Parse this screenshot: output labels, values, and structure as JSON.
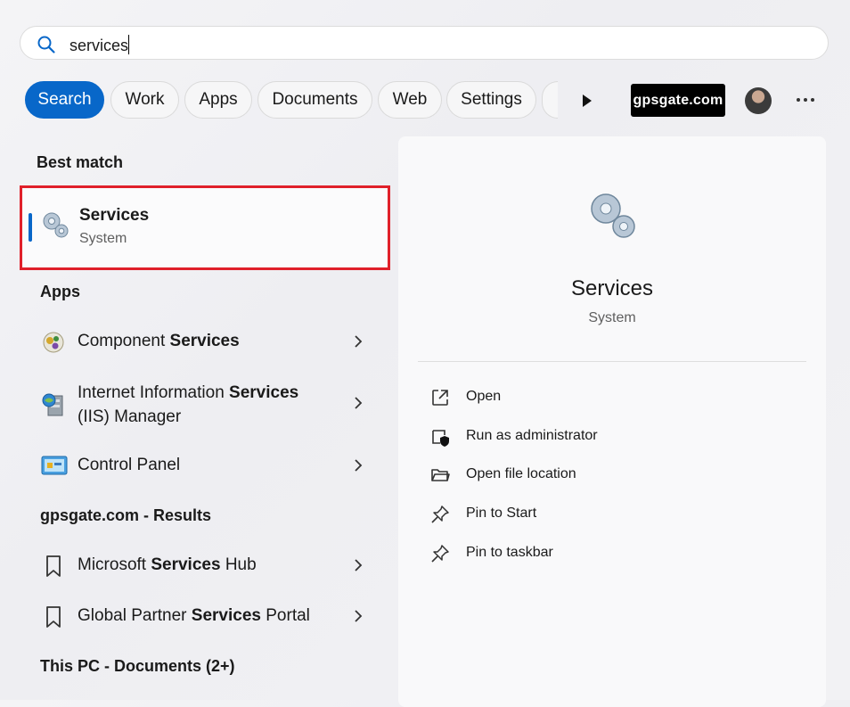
{
  "search": {
    "value": "services"
  },
  "filters": [
    {
      "label": "Search"
    },
    {
      "label": "Work"
    },
    {
      "label": "Apps"
    },
    {
      "label": "Documents"
    },
    {
      "label": "Web"
    },
    {
      "label": "Settings"
    }
  ],
  "brand_chip": "gpsgate.com",
  "sections": {
    "best_match": "Best match",
    "apps": "Apps",
    "gpsgate": "gpsgate.com - Results",
    "documents": "This PC - Documents (2+)"
  },
  "best_match_item": {
    "title": "Services",
    "subtitle": "System"
  },
  "apps": [
    {
      "pre": "Component ",
      "bold": "Services",
      "post": "",
      "line2": ""
    },
    {
      "pre": "Internet Information ",
      "bold": "Services",
      "post": "",
      "line2": "(IIS) Manager"
    },
    {
      "pre": "Control Panel",
      "bold": "",
      "post": "",
      "line2": ""
    }
  ],
  "web_results": [
    {
      "pre": "Microsoft ",
      "bold": "Services",
      "post": " Hub"
    },
    {
      "pre": "Global Partner ",
      "bold": "Services",
      "post": " Portal"
    }
  ],
  "detail": {
    "title": "Services",
    "subtitle": "System",
    "actions": [
      {
        "label": "Open",
        "icon": "open-external-icon"
      },
      {
        "label": "Run as administrator",
        "icon": "shield-admin-icon"
      },
      {
        "label": "Open file location",
        "icon": "folder-icon"
      },
      {
        "label": "Pin to Start",
        "icon": "pin-icon"
      },
      {
        "label": "Pin to taskbar",
        "icon": "pin-icon"
      }
    ]
  },
  "colors": {
    "accent": "#0867c9",
    "highlight_border": "#e0202a"
  }
}
